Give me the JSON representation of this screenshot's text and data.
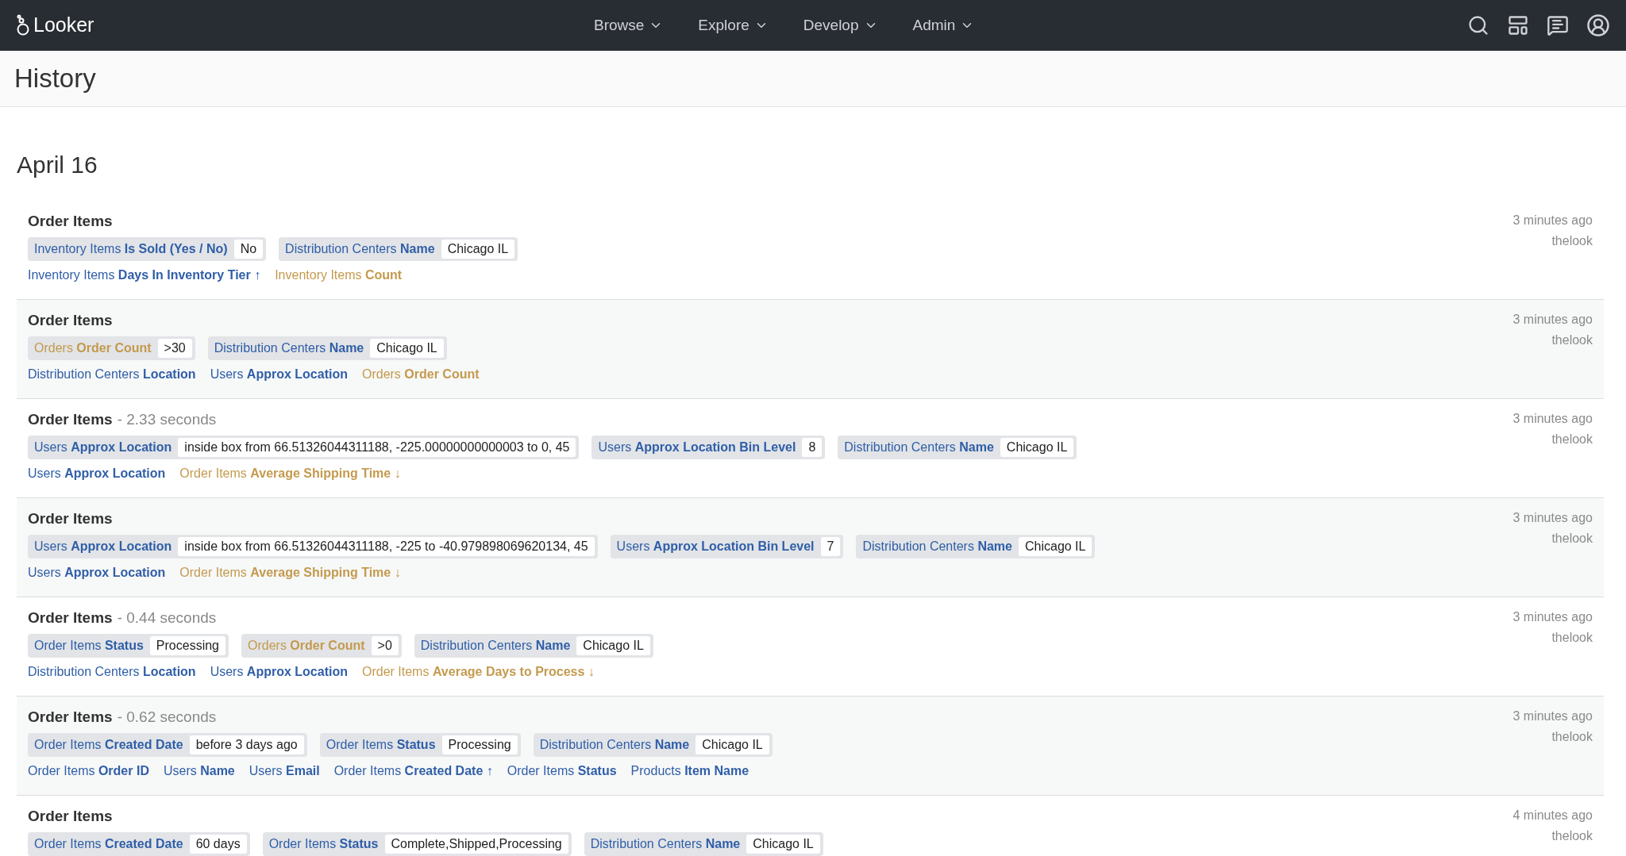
{
  "brand": "Looker",
  "nav": [
    {
      "label": "Browse"
    },
    {
      "label": "Explore"
    },
    {
      "label": "Develop"
    },
    {
      "label": "Admin"
    }
  ],
  "page_title": "History",
  "date_heading": "April 16",
  "entries": [
    {
      "title": "Order Items",
      "time": "3 minutes ago",
      "user": "thelook",
      "filters": [
        {
          "kind": "dimension",
          "view": "Inventory Items",
          "field": "Is Sold (Yes / No)",
          "value": "No"
        },
        {
          "kind": "dimension",
          "view": "Distribution Centers",
          "field": "Name",
          "value": "Chicago IL"
        }
      ],
      "fields": [
        {
          "kind": "dimension",
          "view": "Inventory Items",
          "field": "Days In Inventory Tier",
          "sort": "↑"
        },
        {
          "kind": "measure",
          "view": "Inventory Items",
          "field": "Count"
        }
      ]
    },
    {
      "title": "Order Items",
      "time": "3 minutes ago",
      "user": "thelook",
      "filters": [
        {
          "kind": "measure",
          "view": "Orders",
          "field": "Order Count",
          "value": ">30"
        },
        {
          "kind": "dimension",
          "view": "Distribution Centers",
          "field": "Name",
          "value": "Chicago IL"
        }
      ],
      "fields": [
        {
          "kind": "dimension",
          "view": "Distribution Centers",
          "field": "Location"
        },
        {
          "kind": "dimension",
          "view": "Users",
          "field": "Approx Location"
        },
        {
          "kind": "measure",
          "view": "Orders",
          "field": "Order Count"
        }
      ]
    },
    {
      "title": "Order Items",
      "duration": "- 2.33 seconds",
      "time": "3 minutes ago",
      "user": "thelook",
      "filters": [
        {
          "kind": "dimension",
          "view": "Users",
          "field": "Approx Location",
          "value": "inside box from 66.51326044311188, -225.00000000000003 to 0, 45"
        },
        {
          "kind": "dimension",
          "view": "Users",
          "field": "Approx Location Bin Level",
          "value": "8"
        },
        {
          "kind": "dimension",
          "view": "Distribution Centers",
          "field": "Name",
          "value": "Chicago IL"
        }
      ],
      "fields": [
        {
          "kind": "dimension",
          "view": "Users",
          "field": "Approx Location"
        },
        {
          "kind": "measure",
          "view": "Order Items",
          "field": "Average Shipping Time",
          "sort": "↓"
        }
      ]
    },
    {
      "title": "Order Items",
      "time": "3 minutes ago",
      "user": "thelook",
      "filters": [
        {
          "kind": "dimension",
          "view": "Users",
          "field": "Approx Location",
          "value": "inside box from 66.51326044311188, -225 to -40.979898069620134, 45"
        },
        {
          "kind": "dimension",
          "view": "Users",
          "field": "Approx Location Bin Level",
          "value": "7"
        },
        {
          "kind": "dimension",
          "view": "Distribution Centers",
          "field": "Name",
          "value": "Chicago IL"
        }
      ],
      "fields": [
        {
          "kind": "dimension",
          "view": "Users",
          "field": "Approx Location"
        },
        {
          "kind": "measure",
          "view": "Order Items",
          "field": "Average Shipping Time",
          "sort": "↓"
        }
      ]
    },
    {
      "title": "Order Items",
      "duration": "- 0.44 seconds",
      "time": "3 minutes ago",
      "user": "thelook",
      "filters": [
        {
          "kind": "dimension",
          "view": "Order Items",
          "field": "Status",
          "value": "Processing"
        },
        {
          "kind": "measure",
          "view": "Orders",
          "field": "Order Count",
          "value": ">0"
        },
        {
          "kind": "dimension",
          "view": "Distribution Centers",
          "field": "Name",
          "value": "Chicago IL"
        }
      ],
      "fields": [
        {
          "kind": "dimension",
          "view": "Distribution Centers",
          "field": "Location"
        },
        {
          "kind": "dimension",
          "view": "Users",
          "field": "Approx Location"
        },
        {
          "kind": "measure",
          "view": "Order Items",
          "field": "Average Days to Process",
          "sort": "↓"
        }
      ]
    },
    {
      "title": "Order Items",
      "duration": "- 0.62 seconds",
      "time": "3 minutes ago",
      "user": "thelook",
      "filters": [
        {
          "kind": "dimension",
          "view": "Order Items",
          "field": "Created Date",
          "value": "before 3 days ago"
        },
        {
          "kind": "dimension",
          "view": "Order Items",
          "field": "Status",
          "value": "Processing"
        },
        {
          "kind": "dimension",
          "view": "Distribution Centers",
          "field": "Name",
          "value": "Chicago IL"
        }
      ],
      "fields": [
        {
          "kind": "dimension",
          "view": "Order Items",
          "field": "Order ID"
        },
        {
          "kind": "dimension",
          "view": "Users",
          "field": "Name"
        },
        {
          "kind": "dimension",
          "view": "Users",
          "field": "Email"
        },
        {
          "kind": "dimension",
          "view": "Order Items",
          "field": "Created Date",
          "sort": "↑"
        },
        {
          "kind": "dimension",
          "view": "Order Items",
          "field": "Status"
        },
        {
          "kind": "dimension",
          "view": "Products",
          "field": "Item Name"
        }
      ]
    },
    {
      "title": "Order Items",
      "time": "4 minutes ago",
      "user": "thelook",
      "filters": [
        {
          "kind": "dimension",
          "view": "Order Items",
          "field": "Created Date",
          "value": "60 days"
        },
        {
          "kind": "dimension",
          "view": "Order Items",
          "field": "Status",
          "value": "Complete,Shipped,Processing"
        },
        {
          "kind": "dimension",
          "view": "Distribution Centers",
          "field": "Name",
          "value": "Chicago IL"
        }
      ]
    }
  ]
}
